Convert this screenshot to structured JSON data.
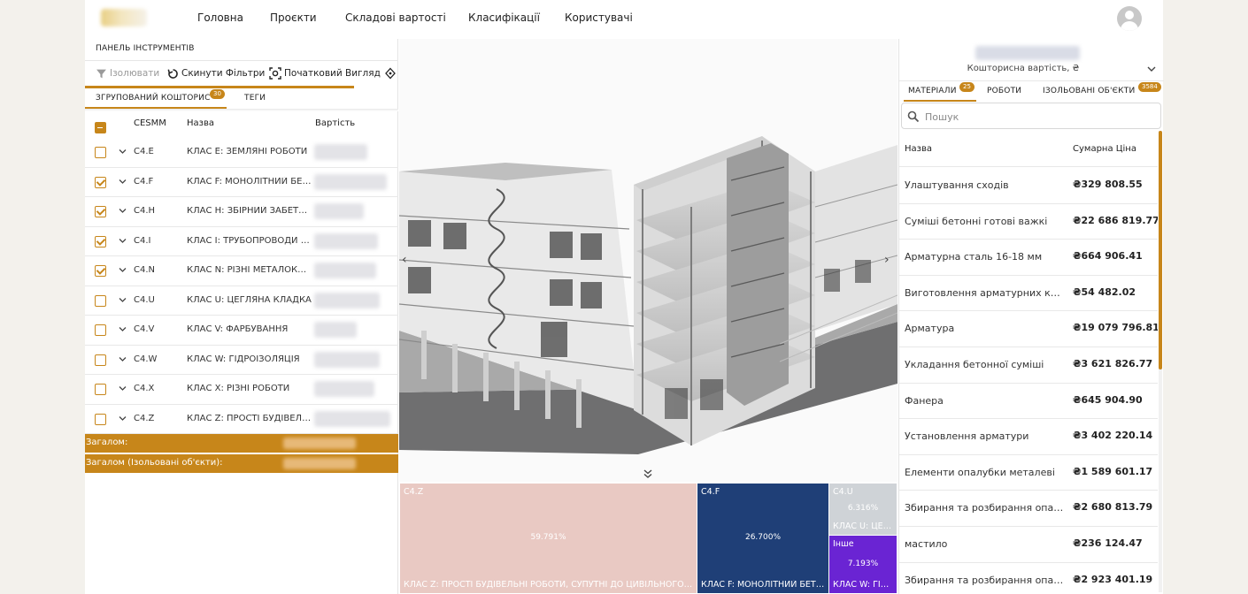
{
  "nav": {
    "items": [
      "Головна",
      "Проєкти",
      "Складові вартості",
      "Класифікації",
      "Користувачі"
    ]
  },
  "toolbar": {
    "title": "ПАНЕЛЬ ІНСТРУМЕНТІВ",
    "isolate_label": "Ізолювати",
    "reset_filters_label": "Скинути Фільтри",
    "initial_view_label": "Початковий Вигляд"
  },
  "left_tabs": {
    "grouped": {
      "label": "ЗГРУПОВАНИЙ КОШТОРИС",
      "badge": "30"
    },
    "tags": {
      "label": "ТЕГИ"
    }
  },
  "grouped_table": {
    "columns": [
      "CESMM",
      "Назва",
      "Вартість"
    ],
    "rows": [
      {
        "code": "C4.E",
        "name": "КЛАС E: ЗЕМЛЯНІ РОБОТИ",
        "checked": false
      },
      {
        "code": "C4.F",
        "name": "КЛАС F: МОНОЛІТНИЙ БЕТОН",
        "checked": true
      },
      {
        "code": "C4.H",
        "name": "КЛАС H: ЗБІРНИЙ ЗАБЕТОНОВАНИЙ",
        "checked": true
      },
      {
        "code": "C4.I",
        "name": "КЛАС I: ТРУБОПРОВОДИ ТА ІНШЕ",
        "checked": true
      },
      {
        "code": "C4.N",
        "name": "КЛАС N: РІЗНІ МЕТАЛОКОНСТРУКЦІЇ",
        "checked": true
      },
      {
        "code": "C4.U",
        "name": "КЛАС U: ЦЕГЛЯНА КЛАДКА",
        "checked": false
      },
      {
        "code": "C4.V",
        "name": "КЛАС V: ФАРБУВАННЯ",
        "checked": false
      },
      {
        "code": "C4.W",
        "name": "КЛАС W: ГІДРОІЗОЛЯЦІЯ",
        "checked": false
      },
      {
        "code": "C4.X",
        "name": "КЛАС X: РІЗНІ РОБОТИ",
        "checked": false
      },
      {
        "code": "C4.Z",
        "name": "КЛАС Z: ПРОСТІ БУДІВЕЛЬНІ РОБОТИ",
        "checked": false
      }
    ],
    "total_label": "Загалом:",
    "total_isolated_label": "Загалом (Ізольовані об'єкти):"
  },
  "treemap": {
    "cells": [
      {
        "code": "C4.Z",
        "percent": "59.791%",
        "label": "КЛАС Z: ПРОСТІ БУДІВЕЛЬНІ РОБОТИ, СУПУТНІ ДО ЦИВІЛЬНОГО БУДІВНИЦТВА",
        "color": "#e9c9c3"
      },
      {
        "code": "C4.F",
        "percent": "26.700%",
        "label": "КЛАС F: МОНОЛІТНИЙ БЕТОН",
        "color": "#1f3f77"
      },
      {
        "code": "C4.U",
        "percent": "6.316%",
        "label": "КЛАС U: ЦЕГЛЯНА КЛАДКА",
        "color": "#cfd3d7"
      },
      {
        "code": "Інше",
        "percent": "7.193%",
        "label": "КЛАС W: ГІДРОІЗОЛЯЦІЯ",
        "color": "#6a24d3"
      }
    ]
  },
  "right_panel": {
    "subtitle": "Кошторисна вартість, ₴",
    "tabs": [
      {
        "label": "МАТЕРІАЛИ",
        "badge": "25"
      },
      {
        "label": "РОБОТИ",
        "badge": ""
      },
      {
        "label": "ІЗОЛЬОВАНІ ОБ'ЄКТИ",
        "badge": "3584"
      }
    ],
    "search_placeholder": "Пошук",
    "columns": [
      "Назва",
      "Сумарна Ціна"
    ],
    "materials": [
      {
        "name": "Улаштування сходів",
        "price": "₴329 808.55"
      },
      {
        "name": "Суміші бетонні готові важкі",
        "price": "₴22 686 819.77"
      },
      {
        "name": "Арматурна сталь 16-18 мм",
        "price": "₴664 906.41"
      },
      {
        "name": "Виготовлення арматурних каркасів",
        "price": "₴54 482.02"
      },
      {
        "name": "Арматура",
        "price": "₴19 079 796.81"
      },
      {
        "name": "Укладання бетонної суміші",
        "price": "₴3 621 826.77"
      },
      {
        "name": "Фанера",
        "price": "₴645 904.90"
      },
      {
        "name": "Установлення арматури",
        "price": "₴3 402 220.14"
      },
      {
        "name": "Елементи опалубки металеві",
        "price": "₴1 589 601.17"
      },
      {
        "name": "Збирання та розбирання опалубки",
        "price": "₴2 680 813.79"
      },
      {
        "name": "мастило",
        "price": "₴236 124.47"
      },
      {
        "name": "Збирання та розбирання опалубки",
        "price": "₴2 923 401.19"
      }
    ]
  },
  "colors": {
    "accent": "#c7861a"
  }
}
